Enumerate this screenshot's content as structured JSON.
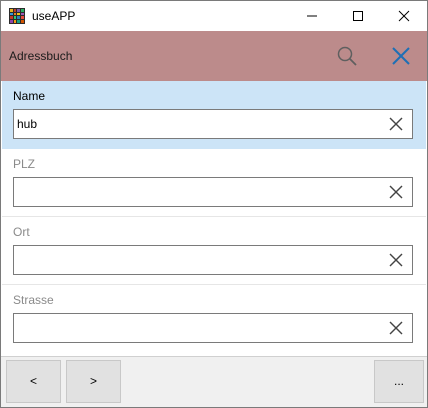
{
  "window": {
    "title": "useAPP"
  },
  "header": {
    "title": "Adressbuch"
  },
  "fields": [
    {
      "label": "Name",
      "value": "hub"
    },
    {
      "label": "PLZ",
      "value": ""
    },
    {
      "label": "Ort",
      "value": ""
    },
    {
      "label": "Strasse",
      "value": ""
    }
  ],
  "footer": {
    "prev_label": "<",
    "next_label": ">",
    "more_label": "..."
  },
  "icons": {
    "app": "app-grid-icon",
    "minimize": "minimize-icon",
    "maximize": "maximize-icon",
    "window_close": "close-icon",
    "search": "search-icon",
    "header_close": "close-icon",
    "field_clear": "clear-icon"
  },
  "colors": {
    "header_bg": "#bc8b8b",
    "active_field_bg": "#cce4f7",
    "accent": "#1e6fb5"
  }
}
